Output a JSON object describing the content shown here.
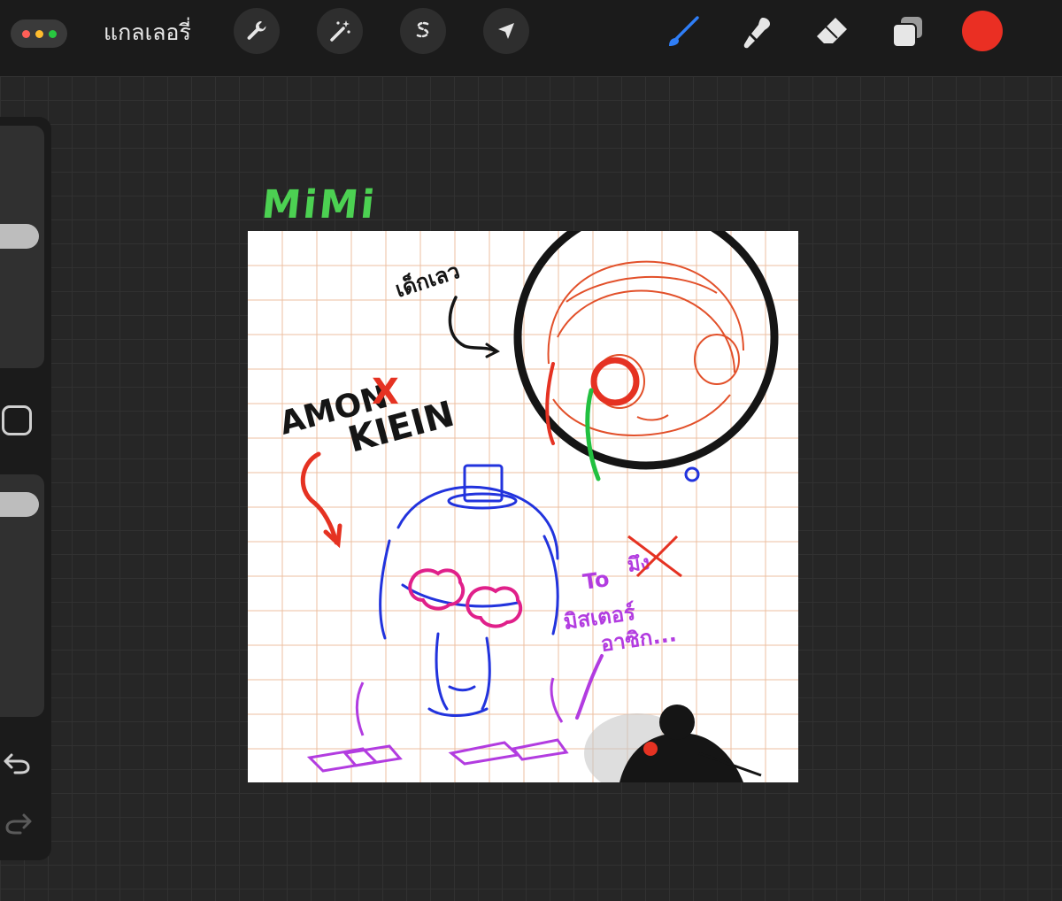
{
  "toolbar": {
    "gallery_label": "แกลเลอรี่",
    "left_tools": [
      "wrench-icon",
      "magic-wand-icon",
      "selection-icon",
      "transform-arrow-icon"
    ],
    "right_tools": [
      "brush-icon",
      "smudge-icon",
      "eraser-icon",
      "layers-icon"
    ],
    "active_tool": "brush",
    "active_color": "#ea2f23"
  },
  "sidebar": {
    "brush_size_level": 0.45,
    "opacity_level": 0.08
  },
  "canvas": {
    "title_text": "MiMi",
    "sketch_texts": {
      "thai_note_top": "เด็กเลว",
      "amon": "AMON",
      "x": "X",
      "klein": "KIEIN",
      "to": "To",
      "crossed": "มึง",
      "mister": "มิสเตอร์",
      "asik": "อาซิก..."
    },
    "colors": {
      "grid_line": "#e8b08a",
      "title": "#4cd152",
      "sketch_red": "#e53222",
      "sketch_blue": "#2233dd",
      "sketch_pink": "#e0208a",
      "sketch_purple": "#b23ce0"
    }
  }
}
